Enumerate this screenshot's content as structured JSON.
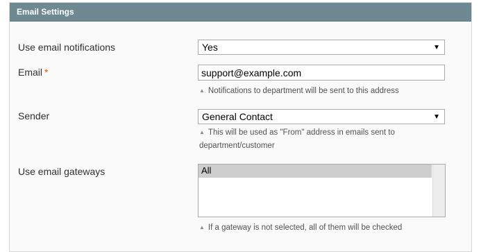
{
  "panel": {
    "title": "Email Settings"
  },
  "rows": {
    "notifications": {
      "label": "Use email notifications",
      "value": "Yes"
    },
    "email": {
      "label": "Email",
      "required_mark": "*",
      "value": "support@example.com",
      "note": "Notifications to department will be sent to this address"
    },
    "sender": {
      "label": "Sender",
      "value": "General Contact",
      "note_line1": "This will be used as \"From\" address in emails sent to",
      "note_line2": "department/customer"
    },
    "gateways": {
      "label": "Use email gateways",
      "options": [
        "All"
      ],
      "note": "If a gateway is not selected, all of them will be checked"
    }
  },
  "icons": {
    "dropdown": "▼",
    "note_marker": "▲"
  }
}
